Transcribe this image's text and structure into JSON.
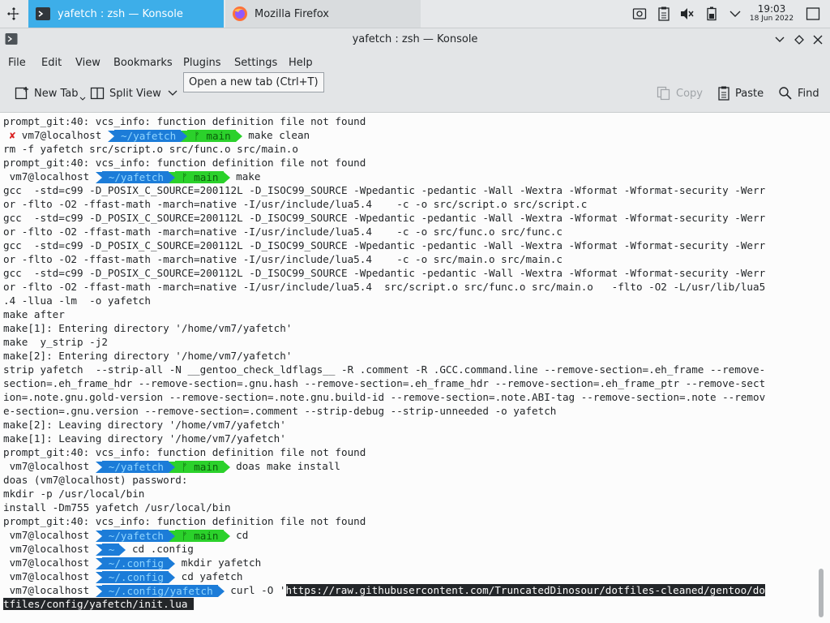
{
  "taskbar": {
    "tasks": [
      {
        "label": "yafetch : zsh — Konsole",
        "icon": "konsole-icon",
        "active": true
      },
      {
        "label": "Mozilla Firefox",
        "icon": "firefox-icon",
        "active": false
      }
    ],
    "tray_icons": [
      "media-icon",
      "clipboard-icon",
      "volume-muted-icon",
      "battery-icon",
      "chevron-down-icon",
      "show-desktop-icon"
    ],
    "clock": {
      "time": "19:03",
      "date": "18 Jun 2022"
    }
  },
  "window": {
    "title": "yafetch : zsh — Konsole",
    "controls": [
      "minimize-icon",
      "maximize-icon",
      "close-icon"
    ]
  },
  "menubar": {
    "items": [
      "File",
      "Edit",
      "View",
      "Bookmarks",
      "Plugins",
      "Settings",
      "Help"
    ]
  },
  "toolbar": {
    "new_tab": "New Tab",
    "split_view": "Split View",
    "copy": "Copy",
    "paste": "Paste",
    "find": "Find",
    "tooltip": "Open a new tab (Ctrl+T)"
  },
  "prompt": {
    "user": "vm7@localhost",
    "fail_mark": "✘",
    "branch_glyph": "ᚠ"
  },
  "terminal": {
    "lines": [
      {
        "type": "text",
        "text": "prompt_git:40: vcs_info: function definition file not found"
      },
      {
        "type": "prompt",
        "fail": true,
        "dir": "~/yafetch",
        "branch": "main",
        "cmd": "make clean"
      },
      {
        "type": "text",
        "text": "rm -f yafetch src/script.o src/func.o src/main.o"
      },
      {
        "type": "text",
        "text": "prompt_git:40: vcs_info: function definition file not found"
      },
      {
        "type": "prompt",
        "fail": false,
        "dir": "~/yafetch",
        "branch": "main",
        "cmd": "make"
      },
      {
        "type": "text",
        "text": "gcc  -std=c99 -D_POSIX_C_SOURCE=200112L -D_ISOC99_SOURCE -Wpedantic -pedantic -Wall -Wextra -Wformat -Wformat-security -Werr"
      },
      {
        "type": "text",
        "text": "or -flto -O2 -ffast-math -march=native -I/usr/include/lua5.4    -c -o src/script.o src/script.c"
      },
      {
        "type": "text",
        "text": "gcc  -std=c99 -D_POSIX_C_SOURCE=200112L -D_ISOC99_SOURCE -Wpedantic -pedantic -Wall -Wextra -Wformat -Wformat-security -Werr"
      },
      {
        "type": "text",
        "text": "or -flto -O2 -ffast-math -march=native -I/usr/include/lua5.4    -c -o src/func.o src/func.c"
      },
      {
        "type": "text",
        "text": "gcc  -std=c99 -D_POSIX_C_SOURCE=200112L -D_ISOC99_SOURCE -Wpedantic -pedantic -Wall -Wextra -Wformat -Wformat-security -Werr"
      },
      {
        "type": "text",
        "text": "or -flto -O2 -ffast-math -march=native -I/usr/include/lua5.4    -c -o src/main.o src/main.c"
      },
      {
        "type": "text",
        "text": "gcc  -std=c99 -D_POSIX_C_SOURCE=200112L -D_ISOC99_SOURCE -Wpedantic -pedantic -Wall -Wextra -Wformat -Wformat-security -Werr"
      },
      {
        "type": "text",
        "text": "or -flto -O2 -ffast-math -march=native -I/usr/include/lua5.4  src/script.o src/func.o src/main.o   -flto -O2 -L/usr/lib/lua5"
      },
      {
        "type": "text",
        "text": ".4 -llua -lm  -o yafetch"
      },
      {
        "type": "text",
        "text": "make after"
      },
      {
        "type": "text",
        "text": "make[1]: Entering directory '/home/vm7/yafetch'"
      },
      {
        "type": "text",
        "text": "make  y_strip -j2"
      },
      {
        "type": "text",
        "text": "make[2]: Entering directory '/home/vm7/yafetch'"
      },
      {
        "type": "text",
        "text": "strip yafetch  --strip-all -N __gentoo_check_ldflags__ -R .comment -R .GCC.command.line --remove-section=.eh_frame --remove-"
      },
      {
        "type": "text",
        "text": "section=.eh_frame_hdr --remove-section=.gnu.hash --remove-section=.eh_frame_hdr --remove-section=.eh_frame_ptr --remove-sect"
      },
      {
        "type": "text",
        "text": "ion=.note.gnu.gold-version --remove-section=.note.gnu.build-id --remove-section=.note.ABI-tag --remove-section=.note --remov"
      },
      {
        "type": "text",
        "text": "e-section=.gnu.version --remove-section=.comment --strip-debug --strip-unneeded -o yafetch"
      },
      {
        "type": "text",
        "text": "make[2]: Leaving directory '/home/vm7/yafetch'"
      },
      {
        "type": "text",
        "text": "make[1]: Leaving directory '/home/vm7/yafetch'"
      },
      {
        "type": "text",
        "text": "prompt_git:40: vcs_info: function definition file not found"
      },
      {
        "type": "prompt",
        "fail": false,
        "dir": "~/yafetch",
        "branch": "main",
        "cmd": "doas make install"
      },
      {
        "type": "text",
        "text": "doas (vm7@localhost) password:"
      },
      {
        "type": "text",
        "text": "mkdir -p /usr/local/bin"
      },
      {
        "type": "text",
        "text": "install -Dm755 yafetch /usr/local/bin"
      },
      {
        "type": "text",
        "text": "prompt_git:40: vcs_info: function definition file not found"
      },
      {
        "type": "prompt",
        "fail": false,
        "dir": "~/yafetch",
        "branch": "main",
        "cmd": "cd"
      },
      {
        "type": "prompt",
        "fail": false,
        "dir": "~",
        "branch": null,
        "cmd": "cd .config"
      },
      {
        "type": "prompt",
        "fail": false,
        "dir": "~/.config",
        "branch": null,
        "cmd": "mkdir yafetch"
      },
      {
        "type": "prompt",
        "fail": false,
        "dir": "~/.config",
        "branch": null,
        "cmd": "cd yafetch"
      },
      {
        "type": "prompt",
        "fail": false,
        "dir": "~/.config/yafetch",
        "branch": null,
        "cmd": "curl -O '",
        "selected": "https://raw.githubusercontent.com/TruncatedDinosour/dotfiles-cleaned/gentoo/do"
      },
      {
        "type": "selected",
        "text": "tfiles/config/yafetch/init.lua "
      }
    ]
  }
}
